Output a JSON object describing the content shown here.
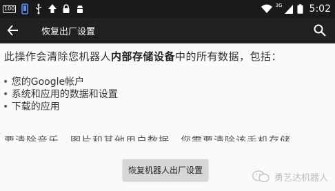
{
  "status_bar": {
    "badge": "100",
    "network": "3G",
    "time": "5:02",
    "icons": [
      "battery-100-icon",
      "phone-icon",
      "usb-icon",
      "upload-icon",
      "lock-icon",
      "android-icon",
      "wifi-icon",
      "signal-icon",
      "battery-icon"
    ]
  },
  "toolbar": {
    "title": "恢复出厂设置",
    "back_icon": "arrow-back-icon",
    "search_icon": "search-icon"
  },
  "content": {
    "desc_prefix": "此操作会清除您机器人",
    "desc_bold": "内部存储设备",
    "desc_suffix": "中的所有数据，包括：",
    "bullets": [
      "您的Google帐户",
      "系统和应用的数据和设置",
      "下载的应用"
    ],
    "partially_hidden_text": "要清除音乐、图片和其他用户数据，您需要清除该手机存储"
  },
  "reset_button": {
    "label": "恢复机器人出厂设置"
  },
  "watermark": {
    "text": "勇艺达机器人"
  },
  "colors": {
    "toolbar": "#212121",
    "status_bar": "#1a1a1a",
    "background": "#fafafa",
    "button": "#d6d6d6"
  }
}
